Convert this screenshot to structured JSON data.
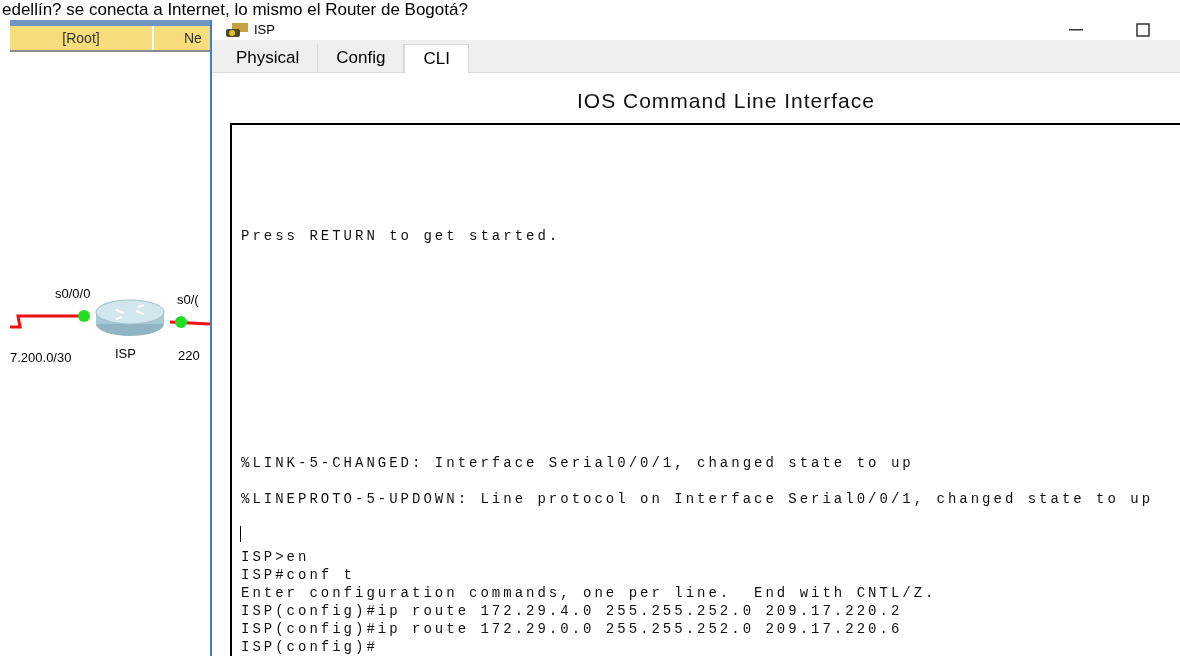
{
  "question": "edellín? se conecta a Internet, lo mismo el Router de Bogotá?",
  "workspace": {
    "breadcrumb": [
      {
        "label": "[Root]"
      },
      {
        "label": "Ne"
      }
    ],
    "topology": {
      "router": {
        "label": "ISP"
      },
      "labels": [
        "s0/0/0",
        "s0/(",
        "7.200.0/30",
        "220"
      ]
    }
  },
  "window": {
    "title": "ISP",
    "tabs": [
      {
        "label": "Physical",
        "selected": false
      },
      {
        "label": "Config",
        "selected": false
      },
      {
        "label": "CLI",
        "selected": true
      }
    ],
    "heading": "IOS Command Line Interface",
    "terminal": {
      "banner": "Press RETURN to get started.",
      "messages": [
        "%LINK-5-CHANGED: Interface Serial0/0/1, changed state to up",
        "%LINEPROTO-5-UPDOWN: Line protocol on Interface Serial0/0/1, changed state to up"
      ],
      "cursor_visible": true,
      "session": [
        "ISP>en",
        "ISP#conf t",
        "Enter configuration commands, one per line.  End with CNTL/Z.",
        "ISP(config)#ip route 172.29.4.0 255.255.252.0 209.17.220.2",
        "ISP(config)#ip route 172.29.0.0 255.255.252.0 209.17.220.6",
        "ISP(config)#"
      ]
    }
  }
}
